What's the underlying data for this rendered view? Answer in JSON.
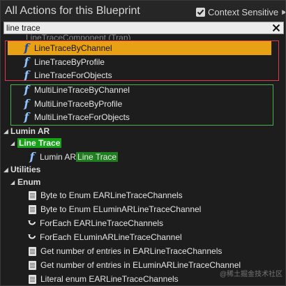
{
  "header": {
    "title": "All Actions for this Blueprint",
    "context_sensitive_label": "Context Sensitive",
    "context_sensitive_checked": true,
    "dropdown_arrow": "▶"
  },
  "search": {
    "value": "line trace",
    "clear_icon": "close-icon"
  },
  "list": {
    "partial_row": "LineTraceComponent (Trap)",
    "function_items_1": [
      "LineTraceByChannel",
      "LineTraceByProfile",
      "LineTraceForObjects"
    ],
    "function_items_2": [
      "MultiLineTraceByChannel",
      "MultiLineTraceByProfile",
      "MultiLineTraceForObjects"
    ],
    "lumin_category": "Lumin AR",
    "line_trace_category": "Line Trace",
    "lumin_item_prefix": "Lumin AR",
    "lumin_item_highlight": "Line Trace",
    "utilities_category": "Utilities",
    "enum_category": "Enum",
    "enum_items": [
      "Byte to Enum EARLineTraceChannels",
      "Byte to Enum ELuminARLineTraceChannel",
      "ForEach EARLineTraceChannels",
      "ForEach ELuminARLineTraceChannel",
      "Get number of entries in EARLineTraceChannels",
      "Get number of entries in ELuminARLineTraceChannel",
      "Literal enum EARLineTraceChannels"
    ],
    "enum_item_icons": [
      "doc-icon",
      "doc-icon",
      "loop-icon",
      "loop-icon",
      "doc-icon",
      "doc-icon",
      "doc-icon"
    ]
  },
  "watermark": "@稀土掘金技术社区",
  "colors": {
    "selected_row": "#e8a014",
    "highlight_green": "#17a317",
    "annotation_red": "#e03a4a",
    "annotation_green": "#4cae4c",
    "function_icon": "#8fc4ff"
  }
}
